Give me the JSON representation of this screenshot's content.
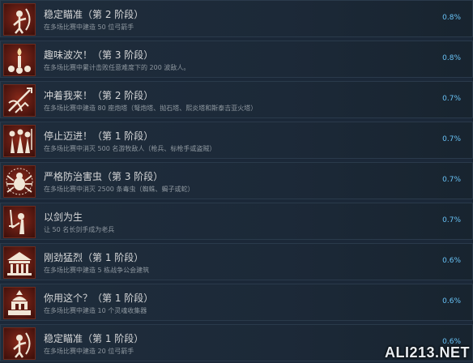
{
  "achievements": [
    {
      "title": "稳定瞄准（第 2 阶段）",
      "desc": "在多场比赛中建造 50 位弓箭手",
      "pct": "0.8%",
      "icon": "archer-bow-icon"
    },
    {
      "title": "趣味波次！（第 3 阶段）",
      "desc": "在多场比赛中累计击败任意难度下的 200 波敌人。",
      "pct": "0.8%",
      "icon": "torch-skulls-icon"
    },
    {
      "title": "冲着我来！（第 2 阶段）",
      "desc": "在多场比赛中建造 80 座炮塔（弩炮塔、抛石塔、熙炎塔和斯泰吉亚火塔）",
      "pct": "0.7%",
      "icon": "ballista-tower-icon"
    },
    {
      "title": "停止迈进！（第 1 阶段）",
      "desc": "在多场比赛中消灭 500 名游牧敌人（枪兵、标枪手或盗贼）",
      "pct": "0.7%",
      "icon": "nomad-warriors-icon"
    },
    {
      "title": "严格防治害虫（第 3 阶段）",
      "desc": "在多场比赛中消灭 2500 条毒虫（蜘蛛、蝎子或蛇）",
      "pct": "0.7%",
      "icon": "spider-icon"
    },
    {
      "title": "以剑为生",
      "desc": "让 50 名长剑手成为老兵",
      "pct": "0.7%",
      "icon": "sword-soldier-icon"
    },
    {
      "title": "刚劲猛烈（第 1 阶段）",
      "desc": "在多场比赛中建造 5 栋战争公会建筑",
      "pct": "0.6%",
      "icon": "war-guild-icon"
    },
    {
      "title": "你用这个？（第 1 阶段）",
      "desc": "在多场比赛中建造 10 个灵魂收集器",
      "pct": "0.6%",
      "icon": "soul-collector-icon"
    },
    {
      "title": "稳定瞄准（第 1 阶段）",
      "desc": "在多场比赛中建造 20 位弓箭手",
      "pct": "0.6%",
      "icon": "archer-bow-icon"
    }
  ],
  "watermark": "ALI213.NET"
}
